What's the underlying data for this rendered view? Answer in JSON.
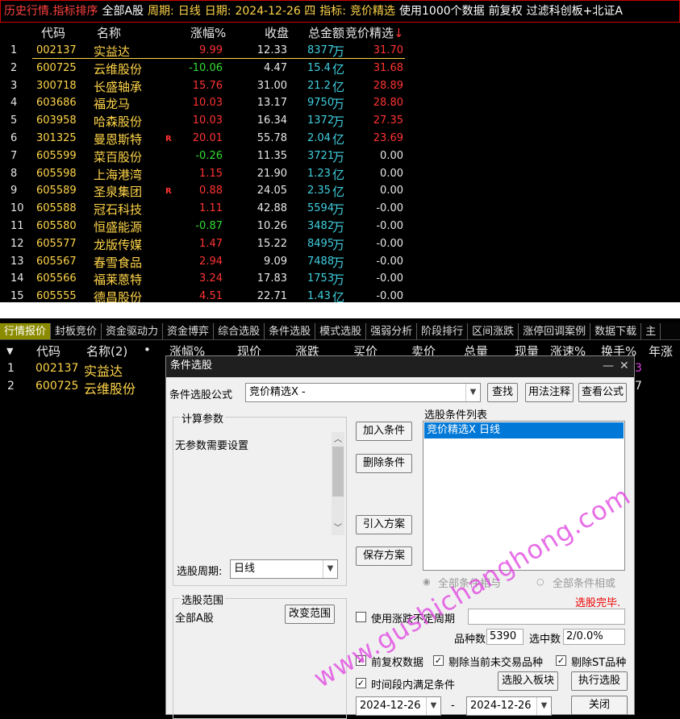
{
  "top": {
    "title": {
      "segments": [
        {
          "text": "历史行情.指标排序",
          "color": "#ff4040"
        },
        {
          "text": "全部A股",
          "color": "#ffffff"
        },
        {
          "text": "周期:",
          "color": "#ffd54a"
        },
        {
          "text": "日线",
          "color": "#ffd54a"
        },
        {
          "text": "日期:",
          "color": "#ffd54a"
        },
        {
          "text": "2024-12-26 四",
          "color": "#ffd54a"
        },
        {
          "text": "指标:",
          "color": "#ffd54a"
        },
        {
          "text": "竞价精选",
          "color": "#ffd54a"
        },
        {
          "text": "使用1000个数据",
          "color": "#ffffff"
        },
        {
          "text": "前复权",
          "color": "#ffffff"
        },
        {
          "text": "过滤科创板+北证A",
          "color": "#ffffff"
        }
      ]
    },
    "headers": {
      "code": "代码",
      "name": "名称",
      "change": "涨幅%",
      "close": "收盘",
      "amount": "总金额",
      "indicator": "竞价精选",
      "sort_arrow": "↓"
    },
    "rows": [
      {
        "idx": "1",
        "code": "002137",
        "name": "实益达",
        "flag": "",
        "change": "9.99",
        "close": "12.33",
        "amt_num": "8377",
        "amt_unit": "万",
        "ind": "31.70",
        "cc": "#ff3333",
        "ic": "#ff3333"
      },
      {
        "idx": "2",
        "code": "600725",
        "name": "云维股份",
        "flag": "",
        "change": "-10.06",
        "close": "4.47",
        "amt_num": "15.4",
        "amt_unit": "亿",
        "ind": "31.68",
        "cc": "#33dd33",
        "ic": "#ff3333"
      },
      {
        "idx": "3",
        "code": "300718",
        "name": "长盛轴承",
        "flag": "",
        "change": "15.76",
        "close": "31.00",
        "amt_num": "21.2",
        "amt_unit": "亿",
        "ind": "28.89",
        "cc": "#ff3333",
        "ic": "#ff3333"
      },
      {
        "idx": "4",
        "code": "603686",
        "name": "福龙马",
        "flag": "",
        "change": "10.03",
        "close": "13.17",
        "amt_num": "9750",
        "amt_unit": "万",
        "ind": "28.80",
        "cc": "#ff3333",
        "ic": "#ff3333"
      },
      {
        "idx": "5",
        "code": "603958",
        "name": "哈森股份",
        "flag": "",
        "change": "10.03",
        "close": "16.34",
        "amt_num": "1372",
        "amt_unit": "万",
        "ind": "27.35",
        "cc": "#ff3333",
        "ic": "#ff3333"
      },
      {
        "idx": "6",
        "code": "301325",
        "name": "曼恩斯特",
        "flag": "R",
        "change": "20.01",
        "close": "55.78",
        "amt_num": "2.04",
        "amt_unit": "亿",
        "ind": "23.69",
        "cc": "#ff3333",
        "ic": "#ff3333"
      },
      {
        "idx": "7",
        "code": "605599",
        "name": "菜百股份",
        "flag": "",
        "change": "-0.26",
        "close": "11.35",
        "amt_num": "3721",
        "amt_unit": "万",
        "ind": "0.00",
        "cc": "#33dd33",
        "ic": "#e8e8e8"
      },
      {
        "idx": "8",
        "code": "605598",
        "name": "上海港湾",
        "flag": "",
        "change": "1.15",
        "close": "21.90",
        "amt_num": "1.23",
        "amt_unit": "亿",
        "ind": "0.00",
        "cc": "#ff3333",
        "ic": "#e8e8e8"
      },
      {
        "idx": "9",
        "code": "605589",
        "name": "圣泉集团",
        "flag": "R",
        "change": "0.88",
        "close": "24.05",
        "amt_num": "2.35",
        "amt_unit": "亿",
        "ind": "0.00",
        "cc": "#ff3333",
        "ic": "#e8e8e8"
      },
      {
        "idx": "10",
        "code": "605588",
        "name": "冠石科技",
        "flag": "",
        "change": "1.11",
        "close": "42.88",
        "amt_num": "5594",
        "amt_unit": "万",
        "ind": "-0.00",
        "cc": "#ff3333",
        "ic": "#e8e8e8"
      },
      {
        "idx": "11",
        "code": "605580",
        "name": "恒盛能源",
        "flag": "",
        "change": "-0.87",
        "close": "10.26",
        "amt_num": "3482",
        "amt_unit": "万",
        "ind": "-0.00",
        "cc": "#33dd33",
        "ic": "#e8e8e8"
      },
      {
        "idx": "12",
        "code": "605577",
        "name": "龙版传媒",
        "flag": "",
        "change": "1.47",
        "close": "15.22",
        "amt_num": "8495",
        "amt_unit": "万",
        "ind": "-0.00",
        "cc": "#ff3333",
        "ic": "#e8e8e8"
      },
      {
        "idx": "13",
        "code": "605567",
        "name": "春雪食品",
        "flag": "",
        "change": "2.94",
        "close": "9.09",
        "amt_num": "7488",
        "amt_unit": "万",
        "ind": "-0.00",
        "cc": "#ff3333",
        "ic": "#e8e8e8"
      },
      {
        "idx": "14",
        "code": "605566",
        "name": "福莱蒽特",
        "flag": "",
        "change": "3.24",
        "close": "17.83",
        "amt_num": "1753",
        "amt_unit": "万",
        "ind": "-0.00",
        "cc": "#ff3333",
        "ic": "#e8e8e8"
      },
      {
        "idx": "15",
        "code": "605555",
        "name": "德昌股份",
        "flag": "",
        "change": "4.51",
        "close": "22.71",
        "amt_num": "1.43",
        "amt_unit": "亿",
        "ind": "-0.00",
        "cc": "#ff3333",
        "ic": "#e8e8e8"
      }
    ]
  },
  "bottom": {
    "tabs": [
      "行情报价",
      "封板竞价",
      "资金驱动力",
      "资金博弈",
      "综合选股",
      "条件选股",
      "模式选股",
      "强弱分析",
      "阶段排行",
      "区间涨跌",
      "涨停回调案例",
      "数据下载",
      "主"
    ],
    "headers": {
      "arrow": "▼",
      "code": "代码",
      "name": "名称(2)",
      "dot": "•",
      "change": "涨幅%",
      "price": "现价",
      "diff": "涨跌",
      "buy": "买价",
      "sell": "卖价",
      "volume": "总量",
      "cur": "现量",
      "speed": "涨速%",
      "turnover": "换手%",
      "year": "年涨"
    },
    "rows": [
      {
        "idx": "1",
        "code": "002137",
        "name": "实益达"
      },
      {
        "idx": "2",
        "code": "600725",
        "name": "云维股份"
      }
    ],
    "row1_tail": "3",
    "row2_tail": "7"
  },
  "dialog": {
    "title": "条件选股",
    "min_glyph": "—",
    "close_glyph": "✕",
    "formula_label": "条件选股公式",
    "formula_value": "竞价精选X  -",
    "find_btn": "查找",
    "usage_btn": "用法注释",
    "view_btn": "查看公式",
    "params_title": "计算参数",
    "params_text": "无参数需要设置",
    "add_btn": "加入条件",
    "del_btn": "删除条件",
    "import_btn": "引入方案",
    "save_btn": "保存方案",
    "list_title": "选股条件列表",
    "list_items": [
      "竞价精选X  日线"
    ],
    "radio_and": "全部条件相与",
    "radio_or": "全部条件相或",
    "period_label": "选股周期:",
    "period_value": "日线",
    "scope_title": "选股范围",
    "scope_value": "全部A股",
    "change_scope_btn": "改变范围",
    "status": "选股完毕.",
    "unfixed_label": "使用涨跌不定周期",
    "count_label": "品种数",
    "count_value": "5390",
    "hit_label": "选中数",
    "hit_value": "2/0.0%",
    "chk_adjust": "前复权数据",
    "chk_untraded": "剔除当前未交易品种",
    "chk_st": "剔除ST品种",
    "chk_range": "时间段内满足条件",
    "to_block_btn": "选股入板块",
    "run_btn": "执行选股",
    "date_from": "2024-12-26",
    "date_sep": "-",
    "date_to": "2024-12-26",
    "close_btn": "关闭"
  },
  "watermark": "www.gushichanghong.com"
}
